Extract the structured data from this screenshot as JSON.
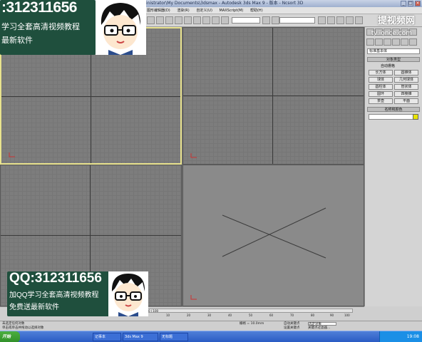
{
  "window": {
    "title": "inistrator\\My Documents\\3dsmax - Autodesk 3ds Max 9 - 版本 - Ncsort 3D"
  },
  "menubar": {
    "items": [
      "图形编辑器(D)",
      "渲染(R)",
      "自定义(U)",
      "MAXScript(M)",
      "帮助(H)"
    ]
  },
  "command_panel": {
    "dropdown": "标准基本体",
    "rollout_object_type": "对象类型",
    "autogrid": "自动栅格",
    "buttons": [
      "长方体",
      "圆锥体",
      "球体",
      "几何球体",
      "圆柱体",
      "管状体",
      "圆环",
      "四棱锥",
      "茶壶",
      "平面"
    ],
    "rollout_name_color": "名称和颜色"
  },
  "timeline": {
    "slider": "0 / 100",
    "ticks": [
      "0",
      "10",
      "20",
      "30",
      "40",
      "50",
      "60",
      "70",
      "80",
      "90",
      "100"
    ]
  },
  "status": {
    "line1": "未选定任何对象",
    "line2": "单击或单击并拖动以选择对象",
    "grid": "栅格 = 10.0mm",
    "autokey": "自动关键点",
    "setkey": "设置关键点",
    "filter": "选定对象",
    "keyfilter": "关键点过滤器..."
  },
  "taskbar": {
    "start": "开始",
    "tasks": [
      "记事本",
      "3ds Max 9",
      "无标题"
    ],
    "clock": "19:08"
  },
  "overlay": {
    "qq_top": ":312311656",
    "line_top_1": "学习全套高清视频教程",
    "line_top_2": "最新软件",
    "qq_bottom": "QQ:312311656",
    "line_bottom_1": "加QQ学习全套高清视频教程",
    "line_bottom_2": "免费送最新软件",
    "watermark": "提视频网",
    "watermark_sub": "tv.ionce.com"
  },
  "colors": {
    "active_border": "#e9e38e",
    "overlay_green": "#1f4f3d",
    "swatch": "#e8e400"
  }
}
